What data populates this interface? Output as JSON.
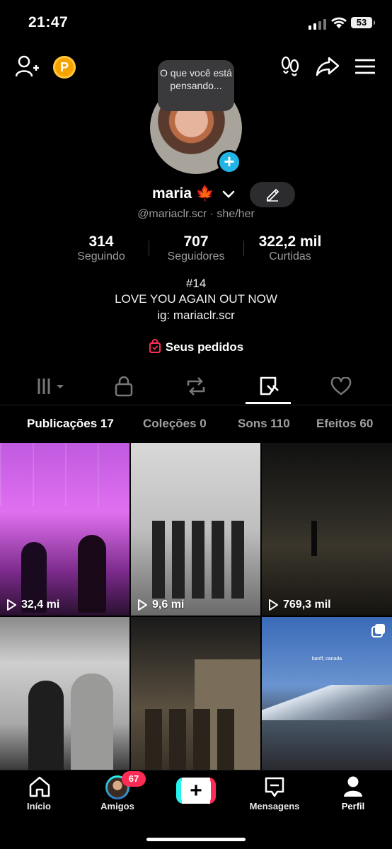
{
  "status": {
    "time": "21:47",
    "battery": "53"
  },
  "profile": {
    "coin_label": "P",
    "bubble_text": "O que você está pensando...",
    "name": "maria 🍁",
    "handle": "@mariaclr.scr · she/her",
    "stats": [
      {
        "value": "314",
        "label": "Seguindo"
      },
      {
        "value": "707",
        "label": "Seguidores"
      },
      {
        "value": "322,2 mil",
        "label": "Curtidas"
      }
    ],
    "bio": [
      "#14",
      "LOVE YOU AGAIN OUT NOW",
      "ig: mariaclr.scr"
    ],
    "orders_label": "Seus pedidos"
  },
  "content_tabs": [
    "grid-icon",
    "lock-icon",
    "repost-icon",
    "tagged-icon",
    "heart-icon"
  ],
  "subtabs": [
    {
      "label": "Publicações 17",
      "active": true
    },
    {
      "label": "Coleções 0",
      "active": false
    },
    {
      "label": "Sons 110",
      "active": false
    },
    {
      "label": "Efeitos 60",
      "active": false
    }
  ],
  "videos": [
    {
      "views": "32,4 mi"
    },
    {
      "views": "9,6 mi"
    },
    {
      "views": "769,3 mil"
    },
    {
      "views": ""
    },
    {
      "views": ""
    },
    {
      "views": "",
      "caption": "banff, canada"
    }
  ],
  "nav": {
    "home": "Início",
    "friends": "Amigos",
    "friends_badge": "67",
    "create": "+",
    "messages": "Mensagens",
    "profile": "Perfil"
  },
  "colors": {
    "accent": "#fe2c55",
    "cyan": "#25f4ee",
    "blue_plus": "#20b5e6",
    "coin": "#f6a300"
  }
}
